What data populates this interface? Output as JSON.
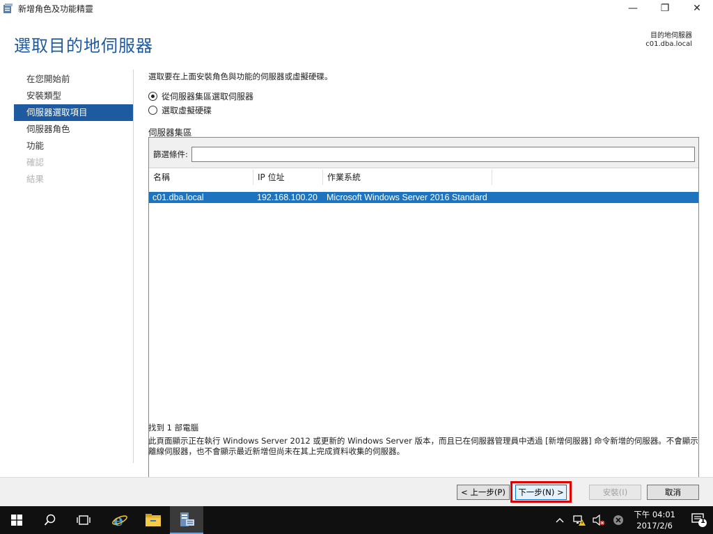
{
  "window": {
    "title": "新增角色及功能精靈",
    "controls": [
      "minimize",
      "maximize",
      "close"
    ]
  },
  "header": {
    "page_title": "選取目的地伺服器",
    "dest_label": "目的地伺服器",
    "dest_server": "c01.dba.local"
  },
  "nav": {
    "items": [
      {
        "label": "在您開始前",
        "state": "normal"
      },
      {
        "label": "安裝類型",
        "state": "normal"
      },
      {
        "label": "伺服器選取項目",
        "state": "active"
      },
      {
        "label": "伺服器角色",
        "state": "normal"
      },
      {
        "label": "功能",
        "state": "normal"
      },
      {
        "label": "確認",
        "state": "disabled"
      },
      {
        "label": "結果",
        "state": "disabled"
      }
    ]
  },
  "main": {
    "instruction": "選取要在上面安裝角色與功能的伺服器或虛擬硬碟。",
    "option_pool": "從伺服器集區選取伺服器",
    "option_vhd": "選取虛擬硬碟",
    "selected_option": "pool",
    "pool_label": "伺服器集區",
    "filter_label": "篩選條件:",
    "filter_value": "",
    "columns": [
      "名稱",
      "IP 位址",
      "作業系統"
    ],
    "rows": [
      {
        "name": "c01.dba.local",
        "ip": "192.168.100.20",
        "os": "Microsoft Windows Server 2016 Standard",
        "selected": true
      }
    ],
    "found_text": "找到 1 部電腦",
    "note_text": "此頁面顯示正在執行 Windows Server 2012 或更新的 Windows Server 版本，而且已在伺服器管理員中透過 [新增伺服器] 命令新增的伺服器。不會顯示離線伺服器，也不會顯示最近新增但尚未在其上完成資料收集的伺服器。"
  },
  "buttons": {
    "prev": "< 上一步(P)",
    "next": "下一步(N) >",
    "install": "安裝(I)",
    "cancel": "取消"
  },
  "taskbar": {
    "time": "下午 04:01",
    "date": "2017/2/6",
    "notification_count": "1"
  },
  "colors": {
    "accent": "#1e5aa0",
    "selection": "#1e73be",
    "highlight_box": "#e00000"
  }
}
